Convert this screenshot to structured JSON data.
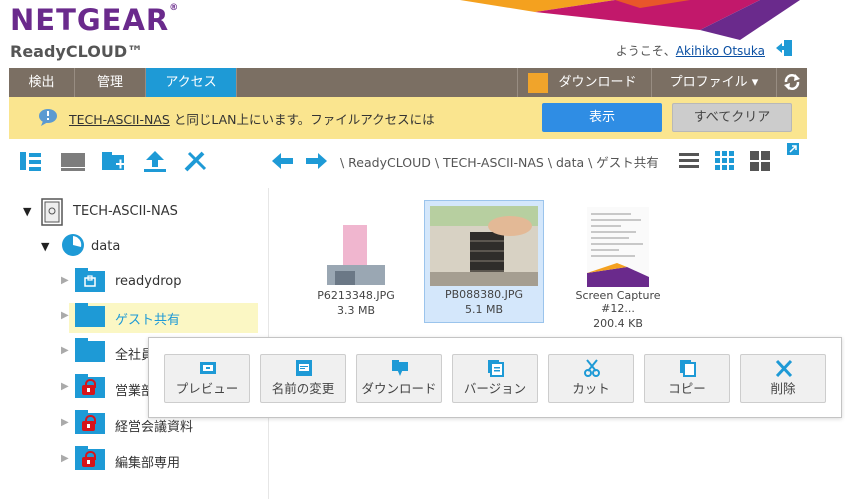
{
  "header": {
    "logo": "NETGEAR",
    "logo_mark": "®",
    "product": "ReadyCLOUD™",
    "welcome_prefix": "ようこそ、",
    "user_name": "Akihiko Otsuka"
  },
  "nav": {
    "tabs": [
      {
        "label": "検出"
      },
      {
        "label": "管理"
      },
      {
        "label": "アクセス"
      }
    ],
    "download_label": "ダウンロード",
    "profile_label": "プロファイル ▾",
    "refresh_icon": "refresh-icon"
  },
  "notice": {
    "device_link": "TECH-ASCII-NAS",
    "message": " と同じLAN上にいます。ファイルアクセスには",
    "show_label": "表示",
    "clear_label": "すべてクリア"
  },
  "breadcrumb": "\\ ReadyCLOUD \\ TECH-ASCII-NAS \\ data \\ ゲスト共有",
  "tree": {
    "device": "TECH-ASCII-NAS",
    "volume": "data",
    "folders": [
      {
        "label": "readydrop",
        "locked": false
      },
      {
        "label": "ゲスト共有",
        "locked": false
      },
      {
        "label": "全社員",
        "locked": false
      },
      {
        "label": "営業部",
        "locked": true
      },
      {
        "label": "経営会議資料",
        "locked": true
      },
      {
        "label": "編集部専用",
        "locked": true
      }
    ]
  },
  "files": [
    {
      "name": "P6213348.JPG",
      "size": "3.3 MB"
    },
    {
      "name": "PB088380.JPG",
      "size": "5.1 MB"
    },
    {
      "name": "Screen Capture #12...",
      "size": "200.4 KB"
    }
  ],
  "context_menu": [
    {
      "label": "プレビュー",
      "icon": "preview-icon"
    },
    {
      "label": "名前の変更",
      "icon": "rename-icon"
    },
    {
      "label": "ダウンロード",
      "icon": "download-icon"
    },
    {
      "label": "バージョン",
      "icon": "versions-icon"
    },
    {
      "label": "カット",
      "icon": "scissors-icon"
    },
    {
      "label": "コピー",
      "icon": "copy-icon"
    },
    {
      "label": "削除",
      "icon": "delete-icon"
    }
  ],
  "colors": {
    "brand": "#6a2a8c",
    "nav": "#7b6f63",
    "accent": "#1e9ad6",
    "notice": "#fae58f",
    "primary_button": "#2f8de4"
  }
}
